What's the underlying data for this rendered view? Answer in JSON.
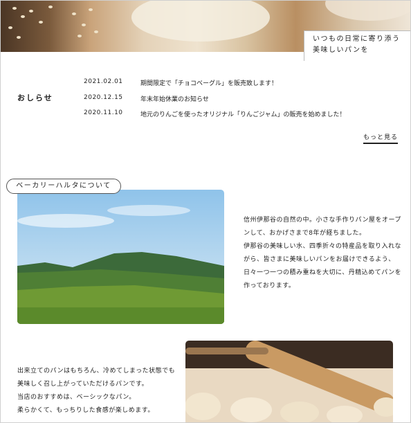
{
  "hero": {
    "tagline_line1": "いつもの日常に寄り添う",
    "tagline_line2": "美味しいパンを"
  },
  "news": {
    "title": "おしらせ",
    "items": [
      {
        "date": "2021.02.01",
        "text": "期間限定で「チョコベーグル」を販売致します！"
      },
      {
        "date": "2020.12.15",
        "text": "年末年始休業のお知らせ"
      },
      {
        "date": "2020.11.10",
        "text": "地元のりんごを使ったオリジナル「りんごジャム」の販売を始めました！"
      }
    ],
    "more_label": "もっと見る"
  },
  "about": {
    "heading": "ベーカリーハルタについて",
    "lines": [
      "信州伊那谷の自然の中。小さな手作りパン屋をオープ",
      "ンして、おかげさまで8年が経ちました。",
      "伊那谷の美味しい水、四季折々の特産品を取り入れな",
      "がら、皆さまに美味しいパンをお届けできるよう、",
      "日々一つ一つの積み重ねを大切に、丹精込めてパンを",
      "作っております。"
    ]
  },
  "bread_intro": {
    "lines": [
      "出来立てのパンはもちろん、冷めてしまった状態でも",
      "美味しく召し上がっていただけるパンです。",
      "当店のおすすめは、ベーシックなパン。",
      "柔らかくて、もっちりした食感が楽しめます。"
    ]
  }
}
